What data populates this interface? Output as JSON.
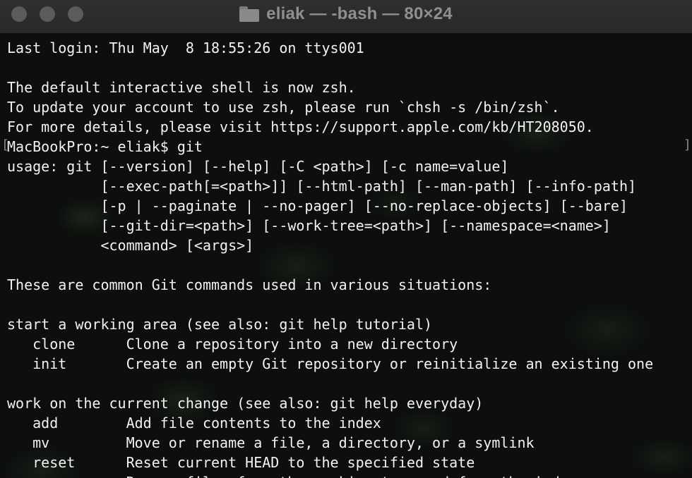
{
  "window": {
    "title": "eliak — -bash — 80×24",
    "title_icon": "folder-icon",
    "traffic_light_color": "#5b5b5b"
  },
  "terminal": {
    "lines": [
      "Last login: Thu May  8 18:55:26 on ttys001",
      "",
      "The default interactive shell is now zsh.",
      "To update your account to use zsh, please run `chsh -s /bin/zsh`.",
      "For more details, please visit https://support.apple.com/kb/HT208050.",
      "MacBookPro:~ eliak$ git",
      "usage: git [--version] [--help] [-C <path>] [-c name=value]",
      "           [--exec-path[=<path>]] [--html-path] [--man-path] [--info-path]",
      "           [-p | --paginate | --no-pager] [--no-replace-objects] [--bare]",
      "           [--git-dir=<path>] [--work-tree=<path>] [--namespace=<name>]",
      "           <command> [<args>]",
      "",
      "These are common Git commands used in various situations:",
      "",
      "start a working area (see also: git help tutorial)",
      "   clone      Clone a repository into a new directory",
      "   init       Create an empty Git repository or reinitialize an existing one",
      "",
      "work on the current change (see also: git help everyday)",
      "   add        Add file contents to the index",
      "   mv         Move or rename a file, a directory, or a symlink",
      "   reset      Reset current HEAD to the specified state",
      "   rm         Remove files from the working tree and from the index"
    ],
    "cursor_marks": {
      "left": "[",
      "right": "]"
    },
    "text_color": "#f2f2f2",
    "background_color": "#0c0f0c"
  }
}
